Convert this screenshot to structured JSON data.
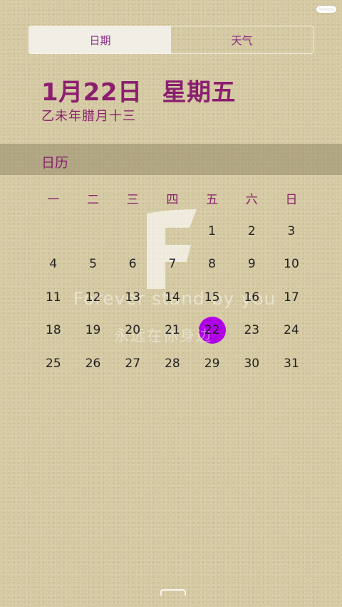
{
  "tabs": [
    {
      "label": "日期",
      "active": true
    },
    {
      "label": "天气",
      "active": false
    }
  ],
  "date": {
    "main": "1月22日",
    "weekday": "星期五",
    "lunar": "乙未年腊月十三"
  },
  "section": {
    "title": "日历"
  },
  "calendar": {
    "weekdays": [
      "一",
      "二",
      "三",
      "四",
      "五",
      "六",
      "日"
    ],
    "weeks": [
      [
        "",
        "",
        "",
        "",
        "1",
        "2",
        "3"
      ],
      [
        "4",
        "5",
        "6",
        "7",
        "8",
        "9",
        "10"
      ],
      [
        "11",
        "12",
        "13",
        "14",
        "15",
        "16",
        "17"
      ],
      [
        "18",
        "19",
        "20",
        "21",
        "22",
        "23",
        "24"
      ],
      [
        "25",
        "26",
        "27",
        "28",
        "29",
        "30",
        "31"
      ]
    ],
    "today": "22"
  },
  "watermark": {
    "letter": "F",
    "motto": "Forever stand by you",
    "motto_cn": "永远在你身边"
  },
  "colors": {
    "accent": "#8a1f6e",
    "today_circle": "#b000e6",
    "background": "#d4c9a2"
  }
}
